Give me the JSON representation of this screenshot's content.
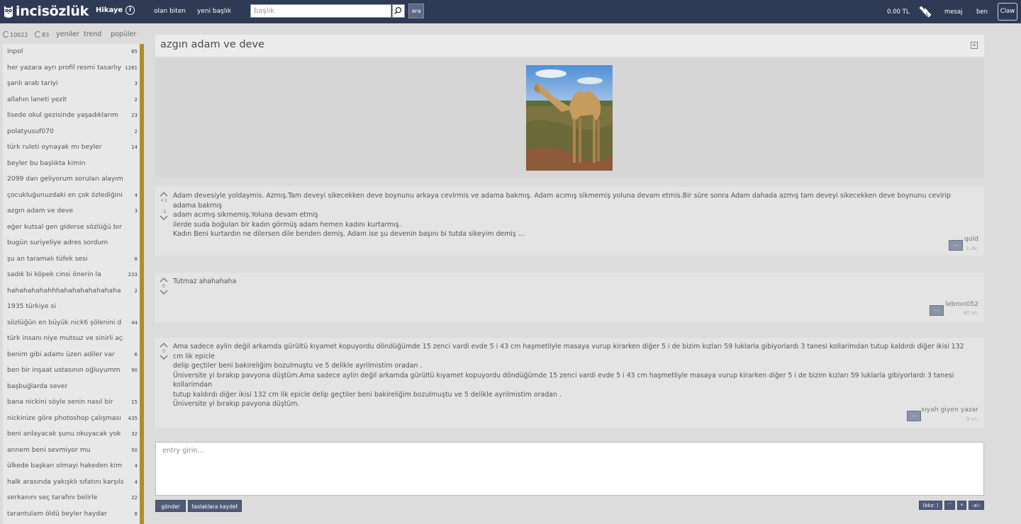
{
  "header": {
    "logo_text": "incisözlük",
    "section": "Hikaye",
    "nav": [
      "olan biten",
      "yeni başlık"
    ],
    "search_placeholder": "başlık",
    "search_button": "ara",
    "balance": "0.00 TL",
    "message": "mesaj",
    "me": "ben",
    "user_button": "Claw"
  },
  "sidebar": {
    "stat1": "10022",
    "stat2": "83",
    "tabs": [
      "yeniler",
      "trend",
      "popüler"
    ],
    "topics": [
      {
        "title": "inpol",
        "count": "85"
      },
      {
        "title": "her yazara ayrı profil resmi tasarlıy",
        "count": "1281"
      },
      {
        "title": "şanlı arab tariyi",
        "count": "3"
      },
      {
        "title": "allahın laneti yezit",
        "count": "2"
      },
      {
        "title": "lisede okul gezisinde yaşadıklarım",
        "count": "23"
      },
      {
        "title": "polatyusuf070",
        "count": "2"
      },
      {
        "title": "türk ruleti oynayak mı beyler",
        "count": "14"
      },
      {
        "title": "beyler bu başlıkta kimin",
        "count": ""
      },
      {
        "title": "2099 dan geliyorum soruları alayım",
        "count": ""
      },
      {
        "title": "çocukluğunuzdaki en çok özlediğini",
        "count": "4"
      },
      {
        "title": "azgın adam ve deve",
        "count": "3"
      },
      {
        "title": "eğer kutsal gen giderse sözlüğü bır",
        "count": ""
      },
      {
        "title": "bugün suriyeliye adres sordum",
        "count": ""
      },
      {
        "title": "şu an taramalı tüfek sesi",
        "count": "8"
      },
      {
        "title": "sadık bi köpek cinsi önerin la",
        "count": "233"
      },
      {
        "title": "hahahahahahhhahahahahahahaha",
        "count": "2"
      },
      {
        "title": "1935 türkiye si",
        "count": ""
      },
      {
        "title": "sözlüğün en büyük nick6 şölenini d",
        "count": "44"
      },
      {
        "title": "türk insanı niye mutsuz ve sinirli açı",
        "count": ""
      },
      {
        "title": "benim gibi adamı üzen adiler var",
        "count": "6"
      },
      {
        "title": "ben bir inşaat ustasının oğluyumm",
        "count": "90"
      },
      {
        "title": "başbuğlarda sever",
        "count": ""
      },
      {
        "title": "bana nickini söyle senin nasıl bir",
        "count": "15"
      },
      {
        "title": "nickinize göre photoshop çalışması",
        "count": "435"
      },
      {
        "title": "beni anlayacak şunu okuyacak yok",
        "count": "32"
      },
      {
        "title": "annem beni sevmiyor mu",
        "count": "50"
      },
      {
        "title": "ülkede başkan olmayi hakeden kim",
        "count": "4"
      },
      {
        "title": "halk arasında yakışklı sıfatını karşıla",
        "count": "4"
      },
      {
        "title": "serkanını seç tarafını belirle",
        "count": "22"
      },
      {
        "title": "tarantulam öldü beyler haydar",
        "count": "8"
      }
    ]
  },
  "topic": {
    "title": "azgın adam ve deve",
    "image_alt": "deve"
  },
  "entries": [
    {
      "up_score": "+1",
      "down_score": "-1",
      "lines": [
        "Adam devesiyle yoldaymis. Azmış.Tam deveyi sikecekken deve boynunu arkaya cevirmis ve adama bakmış. Adam acımış sikmemiş yoluna devam etmis.Bir süre sonra Adam dahada azmış tam deveyi sikecekken deve boynunu cevirip adama bakmış",
        "adam acımış sikmemiş.Yoluna devam etmiş",
        "ilerde suda boğulan bir kadın görmüş adam hemen kadını kurtarmış.",
        "Kadın Beni kurtardın ne dilersen dile benden demiş. Adam ise şu devenin başını bi tutda sikeyim demiş ..."
      ],
      "author": "qold",
      "time": "1 dk."
    },
    {
      "score": "0",
      "lines": [
        "Tutmaz ahahahaha"
      ],
      "author": "lebron052",
      "time": "40 sn."
    },
    {
      "score": "0",
      "lines": [
        "Ama sadece aylin değil arkamda gürültü kıyamet kopuyordu döndüğümde 15 zenci vardi evde 5 i 43 cm haşmetliyle masaya vurup kirarken diğer 5 i de bizim kızları 59 luklarla gibiyorlardı 3 tanesi kollarimdan tutup kaldırdı diğer ikisi 132 cm lik epicle",
        "delip geçtiler beni bakireliğim bozulmuştu ve 5 delikle ayrilmistim oradan .",
        "Üniversite yi bırakıp pavyona düştüm.Ama sadece aylin değil arkamda gürültü kıyamet kopuyordu döndüğümde 15 zenci vardi evde 5 i 43 cm haşmetliyle masaya vurup kirarken diğer 5 i de bizim kızları 59 luklarla gibiyorlardı 3 tanesi kollarimdan",
        "tutup kaldırdı diğer ikisi 132 cm lik epicle delip geçtiler beni bakireliğim bozulmuştu ve 5 delikle ayrilmistim oradan .",
        "Üniversite yi bırakıp pavyona düştüm."
      ],
      "author": "siyah giyen yazar",
      "time": "9 sn."
    }
  ],
  "compose": {
    "placeholder": "entry girin...",
    "submit": "gönder",
    "draft": "taslaklara kaydet",
    "format_buttons": [
      "(bkz: )",
      "``",
      "*",
      "-a!-"
    ]
  },
  "colors": {
    "topbar": "#2f3b55",
    "accent_scrollbar": "#b08d2a",
    "button": "#4f5b78"
  }
}
